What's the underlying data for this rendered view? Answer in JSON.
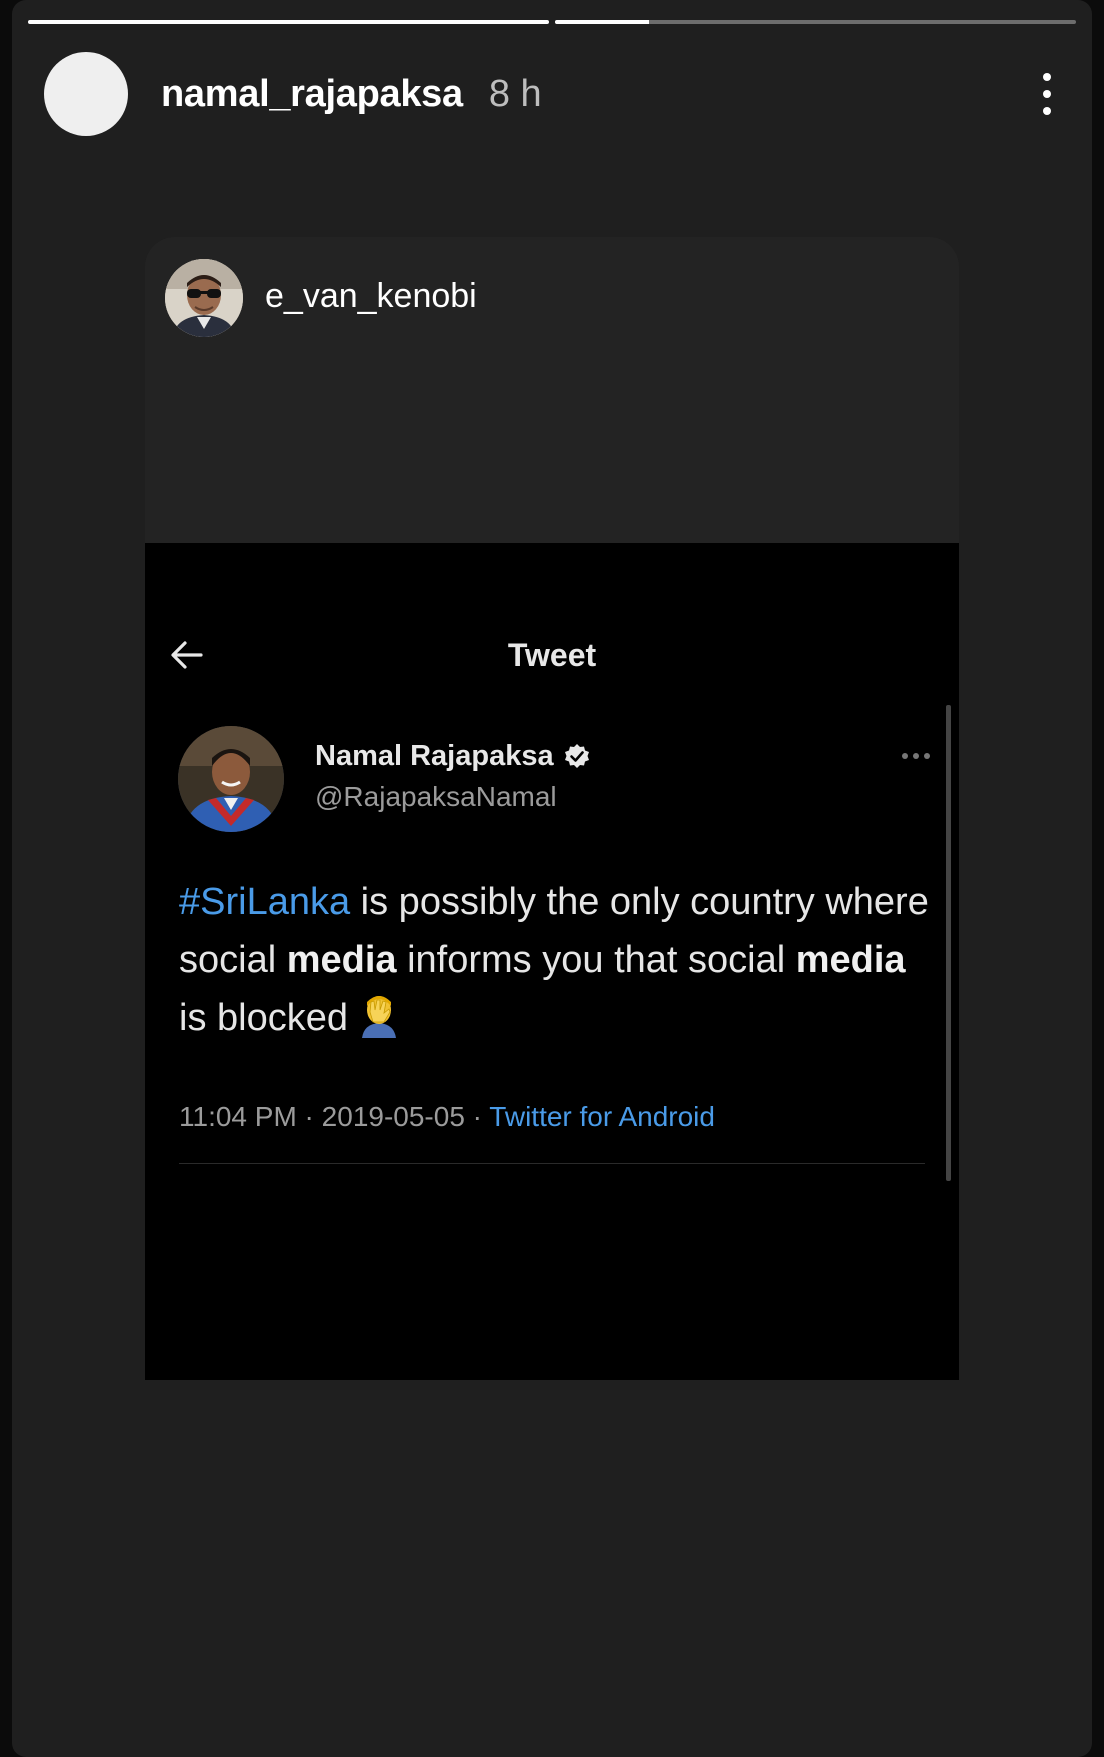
{
  "story": {
    "progress": [
      1.0,
      0.18
    ],
    "username": "namal_rajapaksa",
    "time_ago": "8 h",
    "more_icon": "more-vertical-icon"
  },
  "shared_post": {
    "username": "e_van_kenobi",
    "avatar_icon": "user-photo"
  },
  "tweet_screenshot": {
    "header_title": "Tweet",
    "back_icon": "arrow-left-icon",
    "author_name": "Namal Rajapaksa",
    "author_handle": "@RajapaksaNamal",
    "verified": true,
    "body": {
      "hashtag": "#SriLanka",
      "part1": " is possibly the only country where social ",
      "bold1": "media",
      "part2": " informs you that social ",
      "bold2": "media",
      "part3": " is blocked",
      "emoji_icon": "facepalm-emoji"
    },
    "meta": {
      "time": "11:04 PM",
      "date": "2019-05-05",
      "separator": " · ",
      "source": "Twitter for Android"
    }
  },
  "colors": {
    "story_bg": "#1f1f1f",
    "card_bg": "#232323",
    "tweet_bg": "#000000",
    "link_blue": "#4a9be8"
  }
}
